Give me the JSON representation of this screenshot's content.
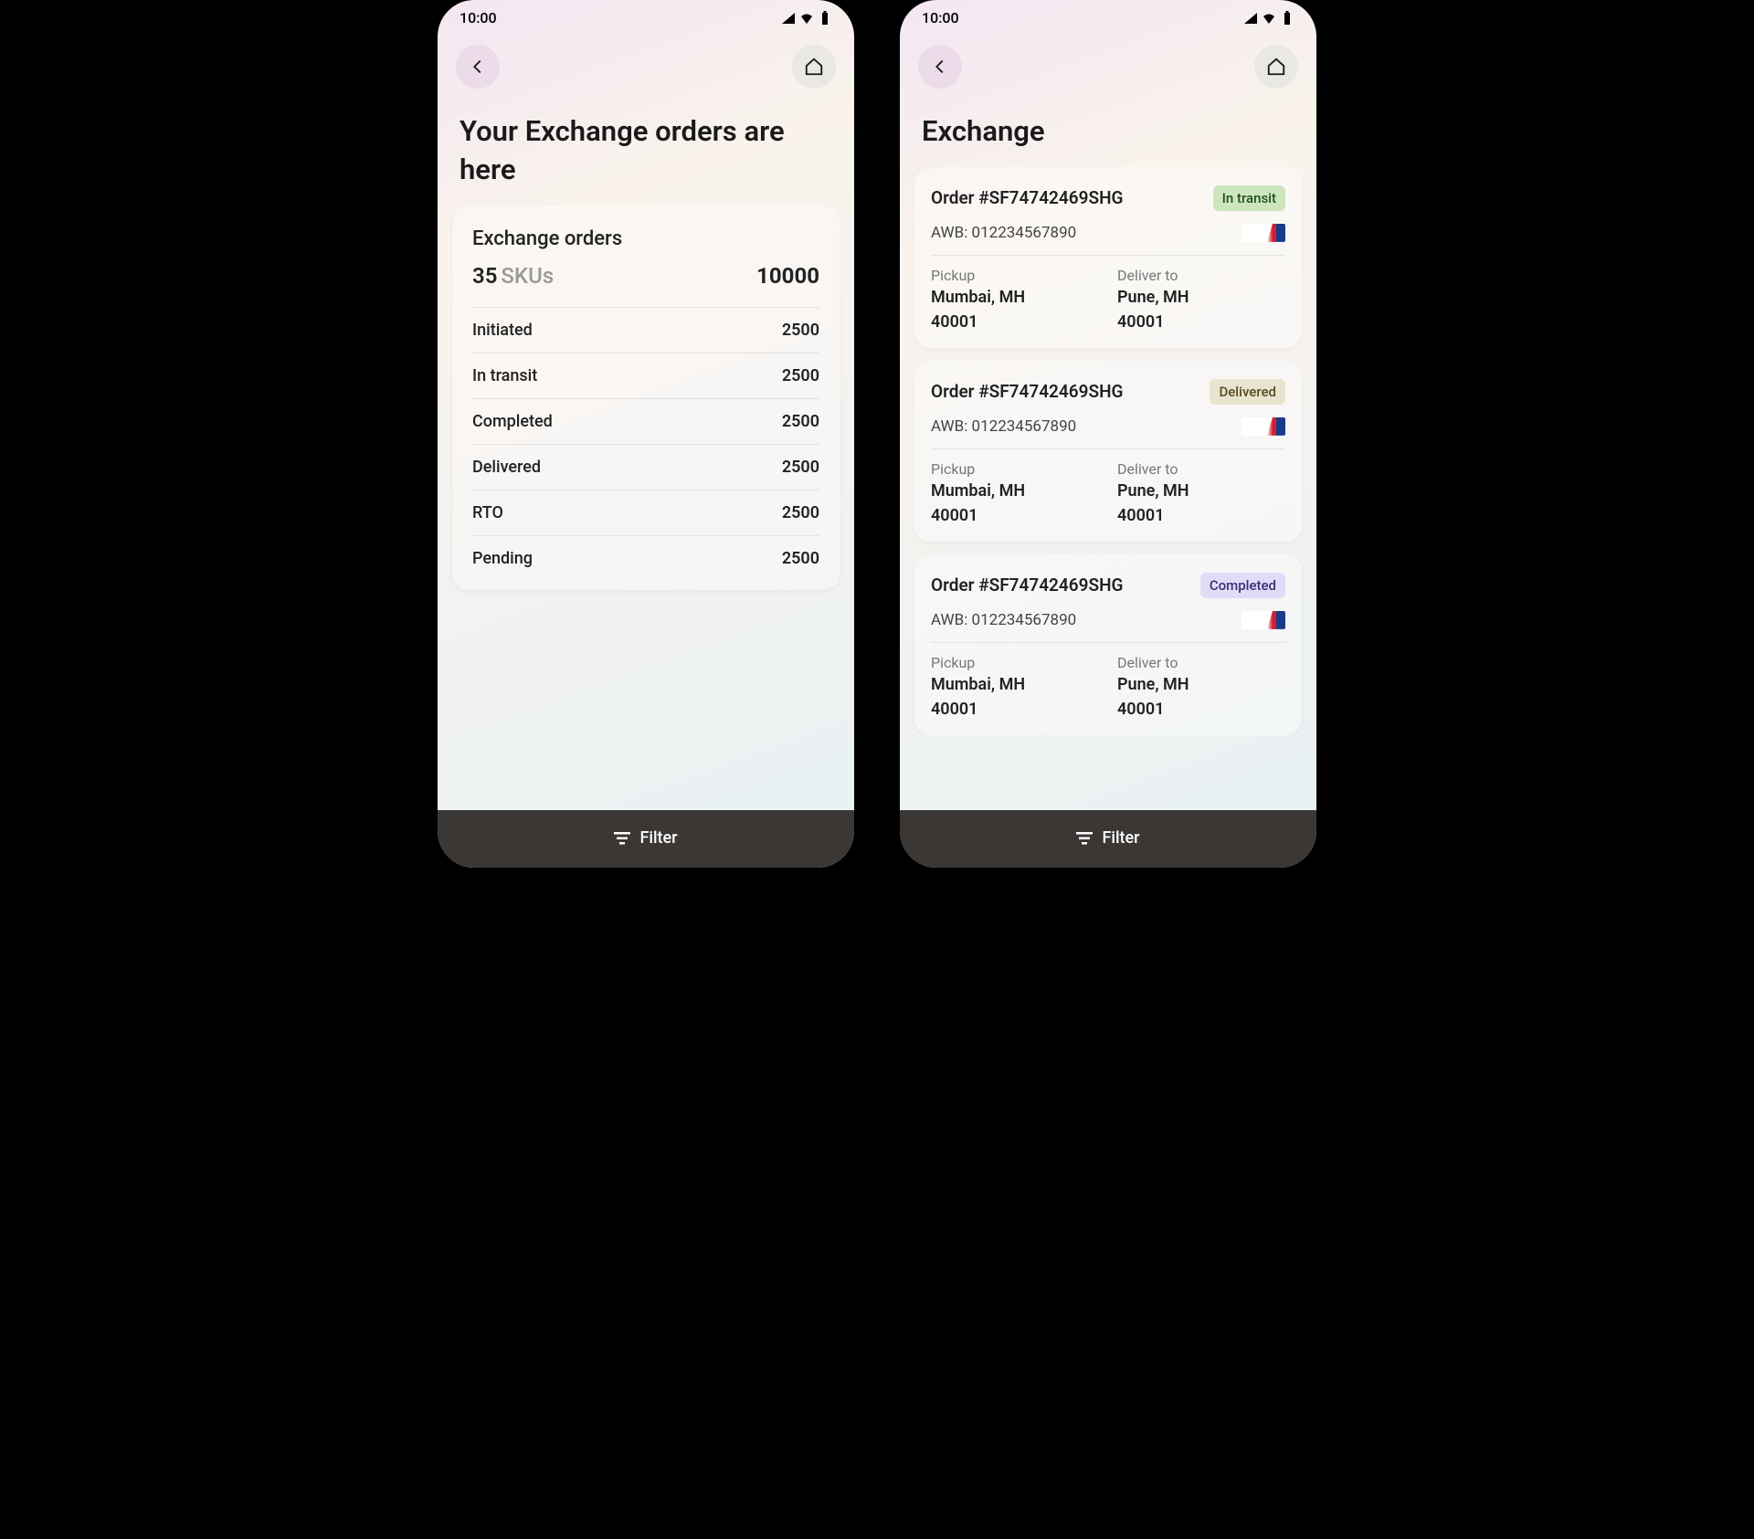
{
  "status_bar": {
    "time": "10:00"
  },
  "screen1": {
    "title": "Your Exchange orders are here",
    "summary": {
      "heading": "Exchange orders",
      "sku_count": "35",
      "sku_label": "SKUs",
      "total": "10000",
      "rows": [
        {
          "label": "Initiated",
          "value": "2500"
        },
        {
          "label": "In transit",
          "value": "2500"
        },
        {
          "label": "Completed",
          "value": "2500"
        },
        {
          "label": "Delivered",
          "value": "2500"
        },
        {
          "label": "RTO",
          "value": "2500"
        },
        {
          "label": "Pending",
          "value": "2500"
        }
      ]
    },
    "filter_label": "Filter"
  },
  "screen2": {
    "title": "Exchange",
    "orders": [
      {
        "id": "Order #SF74742469SHG",
        "status": "In transit",
        "status_class": "badge-transit",
        "awb": "AWB: 012234567890",
        "pickup_label": "Pickup",
        "pickup_city": "Mumbai, MH",
        "pickup_pin": "40001",
        "deliver_label": "Deliver to",
        "deliver_city": "Pune, MH",
        "deliver_pin": "40001"
      },
      {
        "id": "Order #SF74742469SHG",
        "status": "Delivered",
        "status_class": "badge-delivered",
        "awb": "AWB: 012234567890",
        "pickup_label": "Pickup",
        "pickup_city": "Mumbai, MH",
        "pickup_pin": "40001",
        "deliver_label": "Deliver to",
        "deliver_city": "Pune, MH",
        "deliver_pin": "40001"
      },
      {
        "id": "Order #SF74742469SHG",
        "status": "Completed",
        "status_class": "badge-completed",
        "awb": "AWB: 012234567890",
        "pickup_label": "Pickup",
        "pickup_city": "Mumbai, MH",
        "pickup_pin": "40001",
        "deliver_label": "Deliver to",
        "deliver_city": "Pune, MH",
        "deliver_pin": "40001"
      }
    ],
    "filter_label": "Filter"
  }
}
